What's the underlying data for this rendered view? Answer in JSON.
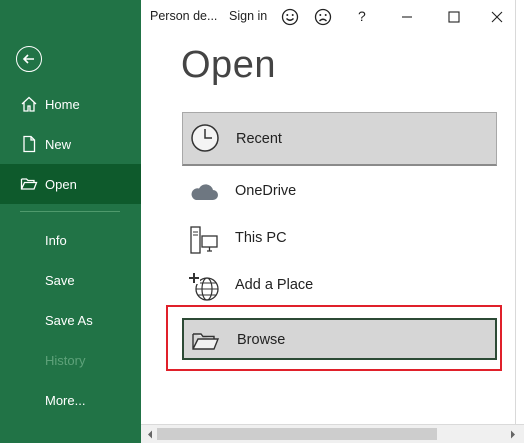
{
  "titlebar": {
    "account": "Person de...",
    "sign_in": "Sign in",
    "help": "?"
  },
  "rail": {
    "items": [
      {
        "label": "Home",
        "icon": "home-icon"
      },
      {
        "label": "New",
        "icon": "new-document-icon"
      },
      {
        "label": "Open",
        "icon": "open-folder-icon",
        "active": true
      },
      {
        "label": "Info"
      },
      {
        "label": "Save"
      },
      {
        "label": "Save As"
      },
      {
        "label": "History",
        "disabled": true
      },
      {
        "label": "More..."
      }
    ]
  },
  "main": {
    "title": "Open",
    "locations": [
      {
        "label": "Recent",
        "icon": "clock-icon",
        "selected": true
      },
      {
        "label": "OneDrive",
        "icon": "cloud-icon"
      },
      {
        "label": "This PC",
        "icon": "computer-icon"
      },
      {
        "label": "Add a Place",
        "icon": "globe-plus-icon"
      },
      {
        "label": "Browse",
        "icon": "folder-icon",
        "highlighted": true
      }
    ]
  },
  "colors": {
    "rail_background": "#217346",
    "rail_active": "#0e5a2c",
    "highlight_border": "#e0202a",
    "selected_background": "#d6d6d6"
  }
}
